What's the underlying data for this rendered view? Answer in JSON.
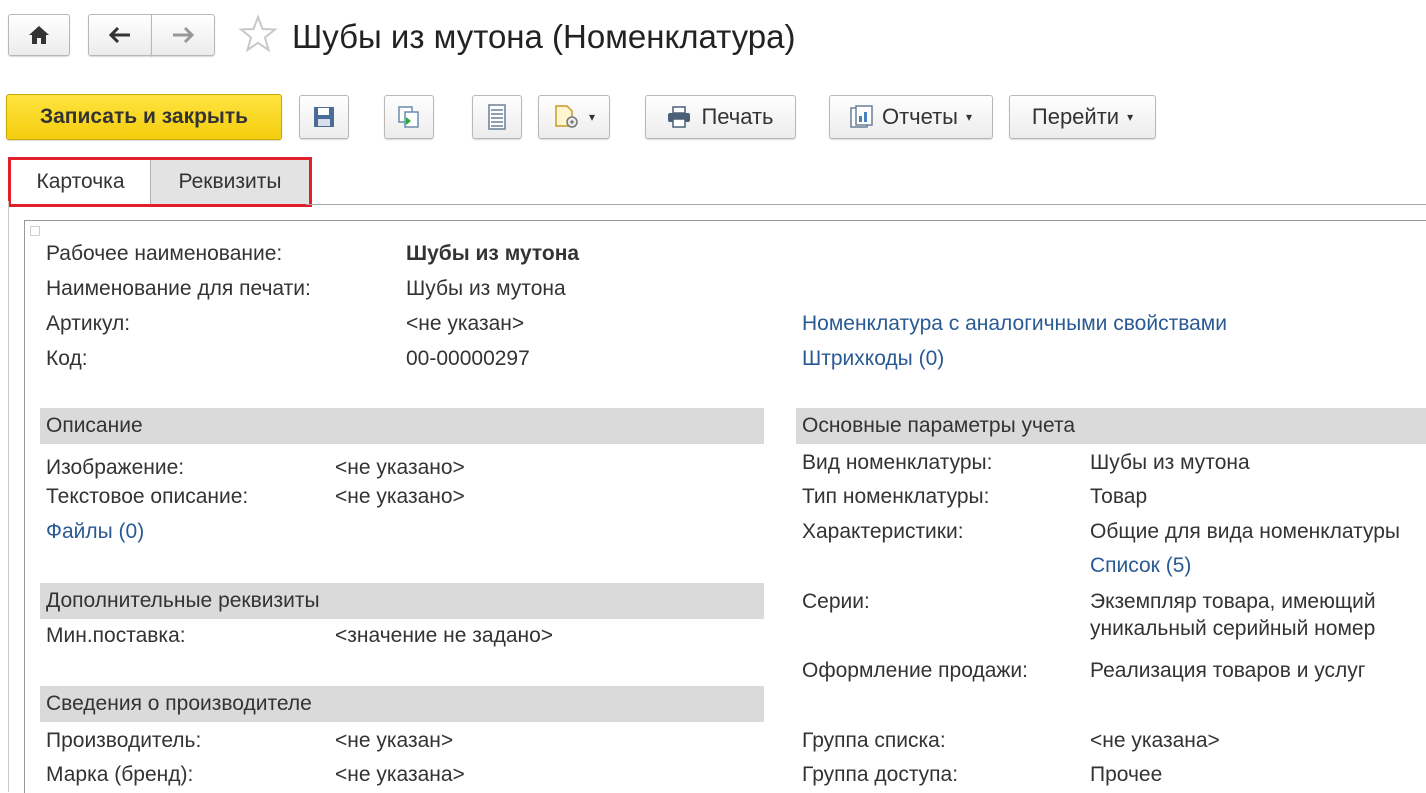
{
  "window": {
    "title": "Шубы из мутона (Номенклатура)"
  },
  "nav": {
    "home_icon": "home-icon",
    "back_icon": "arrow-left-icon",
    "forward_icon": "arrow-right-icon",
    "favorite_icon": "star-icon"
  },
  "toolbar": {
    "save_close_label": "Записать и закрыть",
    "print_label": "Печать",
    "reports_label": "Отчеты",
    "goto_label": "Перейти",
    "dropdown_arrow": "▾"
  },
  "tabs": [
    {
      "label": "Карточка",
      "active": true
    },
    {
      "label": "Реквизиты",
      "active": false
    }
  ],
  "header_fields": {
    "work_name_label": "Рабочее наименование:",
    "work_name_value": "Шубы из мутона",
    "print_name_label": "Наименование для печати:",
    "print_name_value": "Шубы из мутона",
    "article_label": "Артикул:",
    "article_value": "<не указан>",
    "code_label": "Код:",
    "code_value": "00-00000297",
    "similar_link": "Номенклатура с аналогичными свойствами",
    "barcodes_link": "Штрихкоды (0)"
  },
  "description": {
    "title": "Описание",
    "image_label": "Изображение:",
    "image_value": "<не указано>",
    "text_label": "Текстовое описание:",
    "text_value": "<не указано>",
    "files_link": "Файлы (0)"
  },
  "additional": {
    "title": "Дополнительные реквизиты",
    "min_supply_label": "Мин.поставка:",
    "min_supply_value": "<значение не задано>"
  },
  "manufacturer": {
    "title": "Сведения о производителе",
    "maker_label": "Производитель:",
    "maker_value": "<не указан>",
    "brand_label": "Марка (бренд):",
    "brand_value": "<не указана>"
  },
  "accounting": {
    "title": "Основные параметры учета",
    "kind_label": "Вид номенклатуры:",
    "kind_value": "Шубы из мутона",
    "type_label": "Тип номенклатуры:",
    "type_value": "Товар",
    "chars_label": "Характеристики:",
    "chars_value": "Общие для вида номенклатуры",
    "chars_link": "Список (5)",
    "series_label": "Серии:",
    "series_value_1": "Экземпляр товара, имеющий",
    "series_value_2": "уникальный серийный номер",
    "sale_label": "Оформление продажи:",
    "sale_value": "Реализация товаров и услуг",
    "list_group_label": "Группа списка:",
    "list_group_value": "<не указана>",
    "access_group_label": "Группа доступа:",
    "access_group_value": "Прочее"
  },
  "colors": {
    "accent_yellow": "#f4cd0d",
    "link": "#2a5a94",
    "highlight_red": "#e2202c",
    "section_bg": "#dadada"
  }
}
